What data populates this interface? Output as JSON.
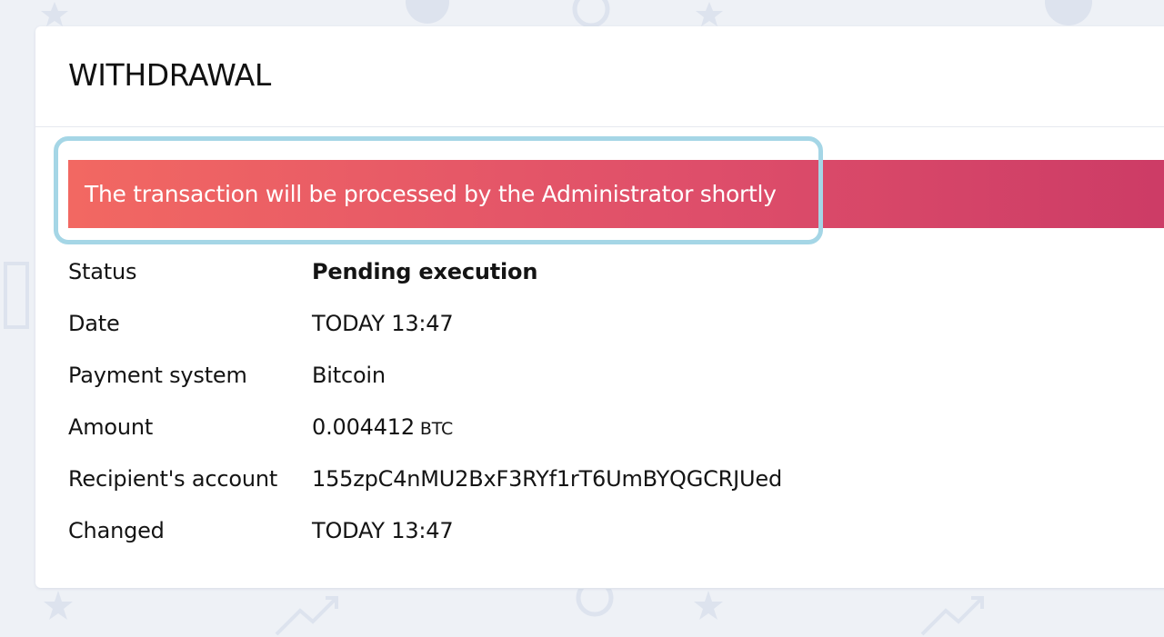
{
  "page": {
    "title": "WITHDRAWAL"
  },
  "alert": {
    "message": "The transaction will be processed by the Administrator shortly",
    "color_start": "#f26862",
    "color_end": "#cc3b66"
  },
  "details": {
    "status": {
      "label": "Status",
      "value": "Pending execution"
    },
    "date": {
      "label": "Date",
      "value": "TODAY 13:47"
    },
    "payment_system": {
      "label": "Payment system",
      "value": "Bitcoin"
    },
    "amount": {
      "label": "Amount",
      "value": "0.004412",
      "currency": "BTC"
    },
    "recipient": {
      "label": "Recipient's account",
      "value": "155zpC4nMU2BxF3RYf1rT6UmBYQGCRJUed"
    },
    "changed": {
      "label": "Changed",
      "value": "TODAY 13:47"
    }
  },
  "colors": {
    "background": "#eef1f6",
    "card": "#ffffff",
    "highlight": "#a5d6e6"
  },
  "background_icons": [
    "star-icon",
    "bitcoin-icon",
    "chart-arrow-icon",
    "chip-icon"
  ]
}
